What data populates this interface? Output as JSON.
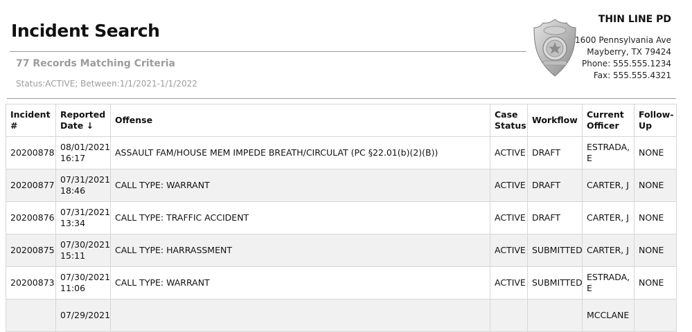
{
  "page": {
    "title": "Incident Search",
    "records_label": "77 Records Matching Criteria",
    "criteria": "Status:ACTIVE; Between:1/1/2021-1/1/2022"
  },
  "department": {
    "name": "THIN LINE PD",
    "address1": "1600 Pennsylvania Ave",
    "address2": "Mayberry, TX 79424",
    "phone": "Phone: 555.555.1234",
    "fax": "Fax: 555.555.4321",
    "badge_icon": "police-badge-icon"
  },
  "table": {
    "headers": {
      "incident": "Incident #",
      "reported": "Reported Date",
      "sort_arrow": "↓",
      "offense": "Offense",
      "case_status": "Case Status",
      "workflow": "Workflow",
      "officer": "Current Officer",
      "followup": "Follow-Up"
    },
    "rows": [
      {
        "incident": "20200878",
        "date": "08/01/2021",
        "time": "16:17",
        "offense": "ASSAULT FAM/HOUSE MEM IMPEDE BREATH/CIRCULAT (PC §22.01(b)(2)(B))",
        "status": "ACTIVE",
        "workflow": "DRAFT",
        "officer": "ESTRADA, E",
        "followup": "NONE"
      },
      {
        "incident": "20200877",
        "date": "07/31/2021",
        "time": "18:46",
        "offense": "CALL TYPE: WARRANT",
        "status": "ACTIVE",
        "workflow": "DRAFT",
        "officer": "CARTER, J",
        "followup": "NONE"
      },
      {
        "incident": "20200876",
        "date": "07/31/2021",
        "time": "13:34",
        "offense": "CALL TYPE: TRAFFIC ACCIDENT",
        "status": "ACTIVE",
        "workflow": "DRAFT",
        "officer": "CARTER, J",
        "followup": "NONE"
      },
      {
        "incident": "20200875",
        "date": "07/30/2021",
        "time": "15:11",
        "offense": "CALL TYPE: HARRASSMENT",
        "status": "ACTIVE",
        "workflow": "SUBMITTED",
        "officer": "CARTER, J",
        "followup": "NONE"
      },
      {
        "incident": "20200873",
        "date": "07/30/2021",
        "time": "11:06",
        "offense": "CALL TYPE: WARRANT",
        "status": "ACTIVE",
        "workflow": "SUBMITTED",
        "officer": "ESTRADA, E",
        "followup": "NONE"
      },
      {
        "incident": "",
        "date": "07/29/2021",
        "time": "",
        "offense": "",
        "status": "",
        "workflow": "",
        "officer": "MCCLANE",
        "followup": ""
      }
    ]
  }
}
